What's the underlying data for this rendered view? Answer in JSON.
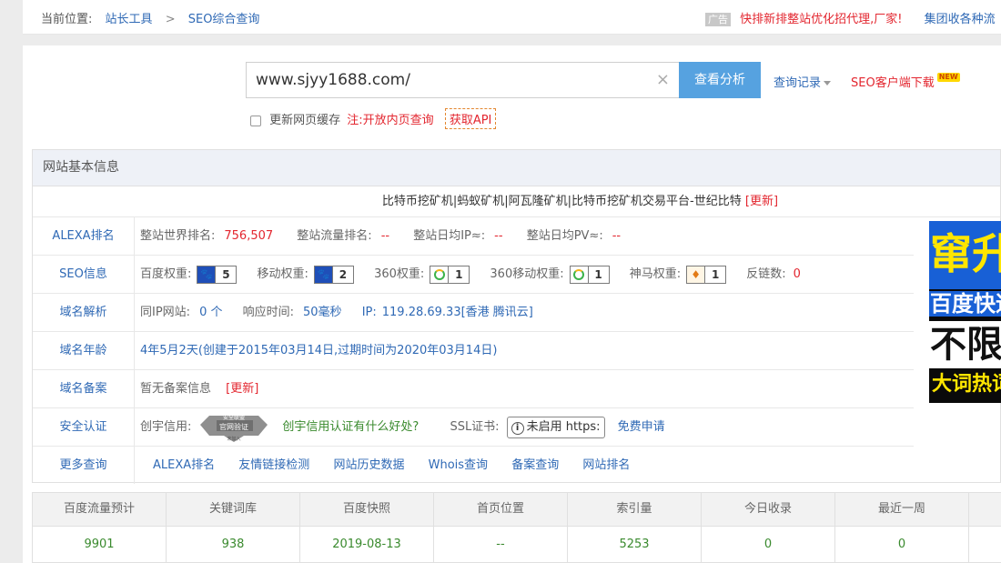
{
  "breadcrumb": {
    "label": "当前位置:",
    "level1": "站长工具",
    "sep": ">",
    "level2": "SEO综合查询"
  },
  "top_ad": {
    "tag": "广告",
    "text": "快排新排整站优化招代理,厂家!",
    "link": "集团收各种流"
  },
  "search": {
    "value": "www.sjyy1688.com/",
    "clear_icon": "×",
    "button": "查看分析",
    "history": "查询记录",
    "client": "SEO客户端下载",
    "client_badge": "NEW",
    "refresh_cache": "更新网页缓存",
    "note": "注:开放内页查询",
    "api": "获取API"
  },
  "basic": {
    "heading": "网站基本信息",
    "site_title": "比特币挖矿机|蚂蚁矿机|阿瓦隆矿机|比特币挖矿机交易平台-世纪比特",
    "site_title_update": "[更新]",
    "alexa": {
      "label": "ALEXA排名",
      "world_label": "整站世界排名:",
      "world_value": "756,507",
      "traffic_label": "整站流量排名:",
      "traffic_value": "--",
      "ip_label": "整站日均IP≈:",
      "ip_value": "--",
      "pv_label": "整站日均PV≈:",
      "pv_value": "--"
    },
    "seo": {
      "label": "SEO信息",
      "baidu_label": "百度权重:",
      "baidu_value": "5",
      "mobile_label": "移动权重:",
      "mobile_value": "2",
      "s360_label": "360权重:",
      "s360_value": "1",
      "s360m_label": "360移动权重:",
      "s360m_value": "1",
      "shenma_label": "神马权重:",
      "shenma_value": "1",
      "backlinks_label": "反链数:",
      "backlinks_value": "0"
    },
    "dns": {
      "label": "域名解析",
      "sameip_label": "同IP网站:",
      "sameip_value": "0 个",
      "resp_label": "响应时间:",
      "resp_value": "50毫秒",
      "ip_label": "IP:",
      "ip_value": "119.28.69.33[香港 腾讯云]"
    },
    "age": {
      "label": "域名年龄",
      "value": "4年5月2天(创建于2015年03月14日,过期时间为2020年03月14日)"
    },
    "icp": {
      "label": "域名备案",
      "value": "暂无备案信息",
      "update": "[更新]"
    },
    "security": {
      "label": "安全认证",
      "credit_label": "创宇信用:",
      "badge_top": "安全联盟",
      "badge_mid": "官网验证",
      "badge_bot": "未加入",
      "credit_link": "创宇信用认证有什么好处?",
      "ssl_label": "SSL证书:",
      "ssl_value": "未启用 https:",
      "ssl_link": "免费申请"
    },
    "more": {
      "label": "更多查询",
      "links": [
        "ALEXA排名",
        "友情链接检测",
        "网站历史数据",
        "Whois查询",
        "备案查询",
        "网站排名"
      ]
    }
  },
  "banner": {
    "line1": "窜升",
    "line2": "百度快速",
    "line3": "不限",
    "line4": "大词热词"
  },
  "stats": {
    "headers": [
      "百度流量预计",
      "关键词库",
      "百度快照",
      "首页位置",
      "索引量",
      "今日收录",
      "最近一周"
    ],
    "values": [
      "9901",
      "938",
      "2019-08-13",
      "--",
      "5253",
      "0",
      "0"
    ]
  }
}
